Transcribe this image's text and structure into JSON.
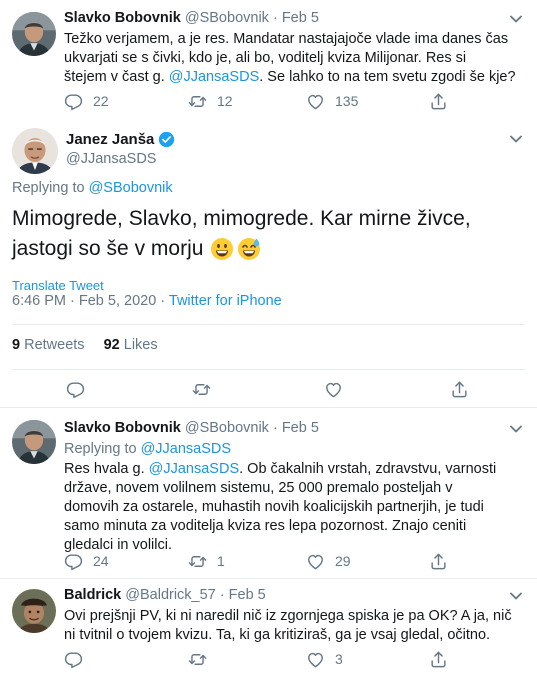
{
  "tweet1": {
    "name": "Slavko Bobovnik",
    "handle": "@SBobovnik",
    "separator": "·",
    "date": "Feb 5",
    "text_lines": [
      "Težko verjamem, a je res. Mandatar nastajajoče vlade ima danes čas",
      "ukvarjati se s čivki, kdo je, ali bo, voditelj kviza Milijonar. Res si"
    ],
    "text_line3_before": "štejem v čast g. ",
    "text_line3_mention": "@JJansaSDS",
    "text_line3_after": ". Se lahko to na tem svetu zgodi še kje?",
    "replies": "22",
    "retweets": "12",
    "likes": "135"
  },
  "main": {
    "name": "Janez Janša",
    "handle": "@JJansaSDS",
    "replying_prefix": "Replying to ",
    "replying_to": "@SBobovnik",
    "text_line1": "Mimogrede, Slavko, mimogrede. Kar mirne živce,",
    "text_line2": "jastogi so še v morju",
    "translate": "Translate Tweet",
    "timestamp": "6:46 PM · Feb 5, 2020 · ",
    "source": "Twitter for iPhone",
    "retweets_count": "9",
    "retweets_label": "Retweets",
    "likes_count": "92",
    "likes_label": "Likes"
  },
  "tweet2": {
    "name": "Slavko Bobovnik",
    "handle": "@SBobovnik",
    "separator": "·",
    "date": "Feb 5",
    "replying_prefix": "Replying to ",
    "replying_to": "@JJansaSDS",
    "line1_before": "Res hvala g. ",
    "line1_mention": "@JJansaSDS",
    "line1_after": ". Ob čakalnih vrstah, zdravstvu, varnosti",
    "text_lines": [
      "države, novem volilnem sistemu, 25 000 premalo posteljah v",
      "domovih za ostarele, muhastih novih koalicijskih partnerjih, je tudi",
      "samo minuta za voditelja kviza res lepa pozornost. Znajo ceniti",
      "gledalci in volilci."
    ],
    "replies": "24",
    "retweets": "1",
    "likes": "29"
  },
  "tweet3": {
    "name": "Baldrick",
    "handle": "@Baldrick_57",
    "separator": "·",
    "date": "Feb 5",
    "text_lines": [
      "Ovi prejšnji PV, ki ni naredil nič iz zgornjega spiska je pa OK? A ja, nič",
      "ni tvitnil o tvojem kvizu. Ta, ki ga kritiziraš, ga je vsaj gledal, očitno."
    ],
    "likes": "3"
  },
  "icons": [
    "reply-icon",
    "retweet-icon",
    "like-icon",
    "share-icon",
    "caret-down-icon",
    "verified-badge-icon"
  ],
  "colors": {
    "link": "#1b95e0",
    "muted": "#657786",
    "text": "#14171a",
    "divider": "#e6ecf0"
  }
}
